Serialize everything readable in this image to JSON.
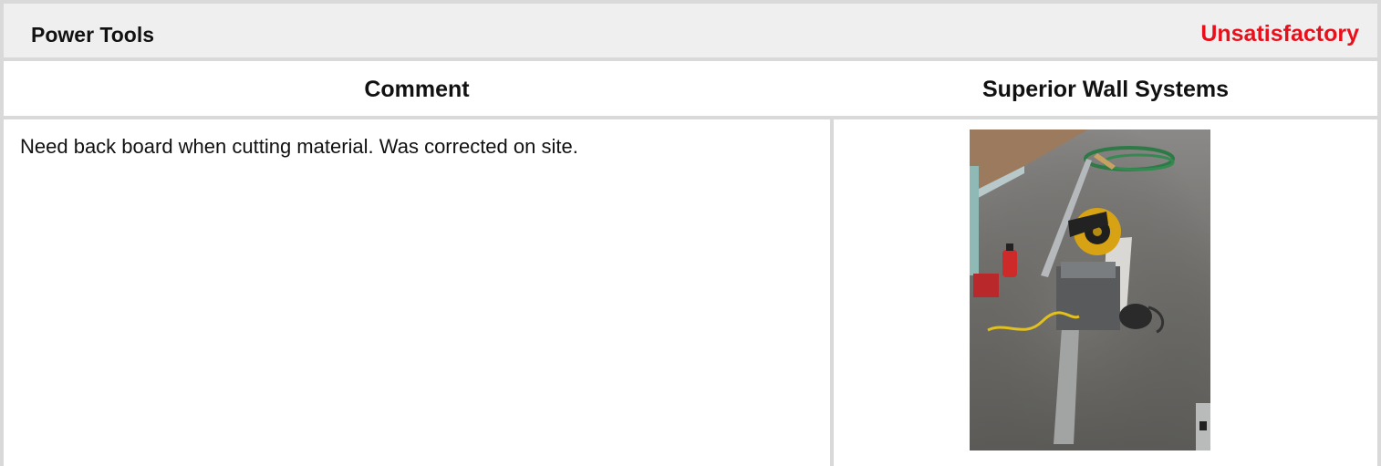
{
  "section": {
    "title": "Power Tools",
    "status": "Unsatisfactory",
    "status_color": "#e8101b"
  },
  "columns": {
    "comment": "Comment",
    "company": "Superior Wall Systems"
  },
  "entry": {
    "comment": "Need back board when cutting material. Was corrected on site."
  },
  "photo": {
    "subject": "site-photo-miter-saw-on-concrete-floor"
  }
}
